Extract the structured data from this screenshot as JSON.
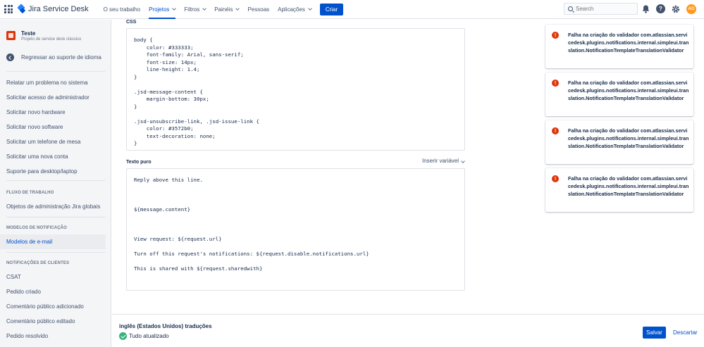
{
  "topnav": {
    "product": "Jira Service Desk",
    "items": [
      {
        "label": "O seu trabalho",
        "caret": false,
        "active": false
      },
      {
        "label": "Projetos",
        "caret": true,
        "active": true
      },
      {
        "label": "Filtros",
        "caret": true,
        "active": false
      },
      {
        "label": "Painéis",
        "caret": true,
        "active": false
      },
      {
        "label": "Pessoas",
        "caret": false,
        "active": false
      },
      {
        "label": "Aplicações",
        "caret": true,
        "active": false
      }
    ],
    "create_label": "Criar",
    "search_placeholder": "Search",
    "avatar_initials": "AG"
  },
  "sidebar": {
    "project_name": "Teste",
    "project_type": "Projeto de service desk clássico",
    "back_label": "Regressar ao suporte de idioma",
    "request_types": [
      "Relatar um problema no sistema",
      "Solicitar acesso de administrador",
      "Solicitar novo hardware",
      "Solicitar novo software",
      "Solicitar um telefone de mesa",
      "Solicitar uma nova conta",
      "Suporte para desktop/laptop"
    ],
    "workflow_heading": "FLUXO DE TRABALHO",
    "workflow_items": [
      "Objetos de administração Jira globais"
    ],
    "notification_heading": "MODELOS DE NOTIFICAÇÃO",
    "notification_items": [
      "Modelos de e-mail"
    ],
    "customer_heading": "NOTIFICAÇÕES DE CLIENTES",
    "customer_items": [
      "CSAT",
      "Pedido criado",
      "Comentário público adicionado",
      "Comentário público editado",
      "Pedido resolvido"
    ]
  },
  "main": {
    "css_label": "CSS",
    "css_lines": [
      "body {",
      "    color: #333333;",
      "    font-family: Arial, sans-serif;",
      "    font-size: 14px;",
      "    line-height: 1.4;",
      "}",
      "",
      ".jsd-message-content {",
      "    margin-bottom: 30px;",
      "}",
      "",
      ".jsd-unsubscribe-link, .jsd-issue-link {",
      "    color: #3572b0;",
      "    text-decoration: none;",
      "}"
    ],
    "plain_label": "Texto puro",
    "insert_variable": "Inserir variável",
    "plain_lines": [
      "Reply above this line.",
      "",
      "",
      "",
      "${message.content}",
      "",
      "",
      "",
      "View request: ${request.url}",
      "",
      "Turn off this request's notifications: ${request.disable.notifications.url}",
      "",
      "This is shared with ${request.sharedwith}"
    ],
    "errors": [
      "Falha na criação do validador com.atlassian.servicedesk.plugins.notifications.internal.simpleui.translation.NotificationTemplateTranslationValidator",
      "Falha na criação do validador com.atlassian.servicedesk.plugins.notifications.internal.simpleui.translation.NotificationTemplateTranslationValidator",
      "Falha na criação do validador com.atlassian.servicedesk.plugins.notifications.internal.simpleui.translation.NotificationTemplateTranslationValidator",
      "Falha na criação do validador com.atlassian.servicedesk.plugins.notifications.internal.simpleui.translation.NotificationTemplateTranslationValidator"
    ],
    "translation_title": "inglês (Estados Unidos) traduções",
    "status": "Tudo atualizado",
    "save_label": "Salvar",
    "discard_label": "Descartar"
  },
  "colors": {
    "brand": "#0052cc",
    "error": "#de350b",
    "success": "#36b37e"
  },
  "icons": [
    "app-switcher-icon",
    "search-icon",
    "bell-icon",
    "help-icon",
    "settings-icon",
    "back-arrow-icon",
    "error-icon",
    "check-circle-icon"
  ]
}
